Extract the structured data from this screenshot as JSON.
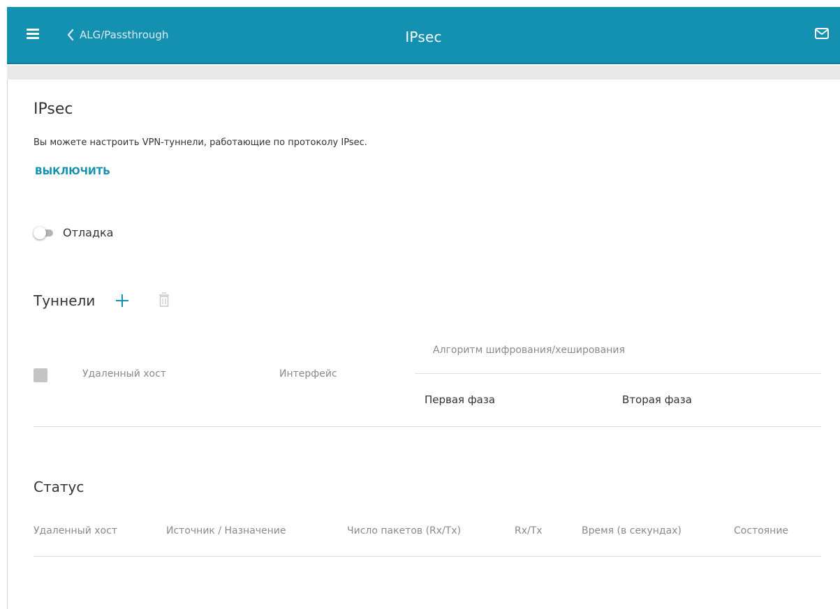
{
  "header": {
    "back_label": "ALG/Passthrough",
    "title": "IPsec"
  },
  "main": {
    "title": "IPsec",
    "description": "Вы можете настроить VPN-туннели, работающие по протоколу IPsec.",
    "disable_link": "ВЫКЛЮЧИТЬ",
    "debug": {
      "label": "Отладка",
      "enabled": false
    }
  },
  "tunnels": {
    "title": "Туннели",
    "columns": {
      "remote_host": "Удаленный хост",
      "interface": "Интерфейс",
      "algorithm_group": "Алгоритм шифрования/хеширования",
      "phase1": "Первая фаза",
      "phase2": "Вторая фаза"
    },
    "rows": []
  },
  "status": {
    "title": "Статус",
    "columns": [
      "Удаленный хост",
      "Источник / Назначение",
      "Число пакетов (Rx/Tx)",
      "Rx/Tx",
      "Время (в секундах)",
      "Состояние"
    ],
    "rows": []
  },
  "colors": {
    "accent": "#1490b0",
    "toggle_off": "#b5b5b5",
    "checkbox": "#c4c4c4"
  }
}
